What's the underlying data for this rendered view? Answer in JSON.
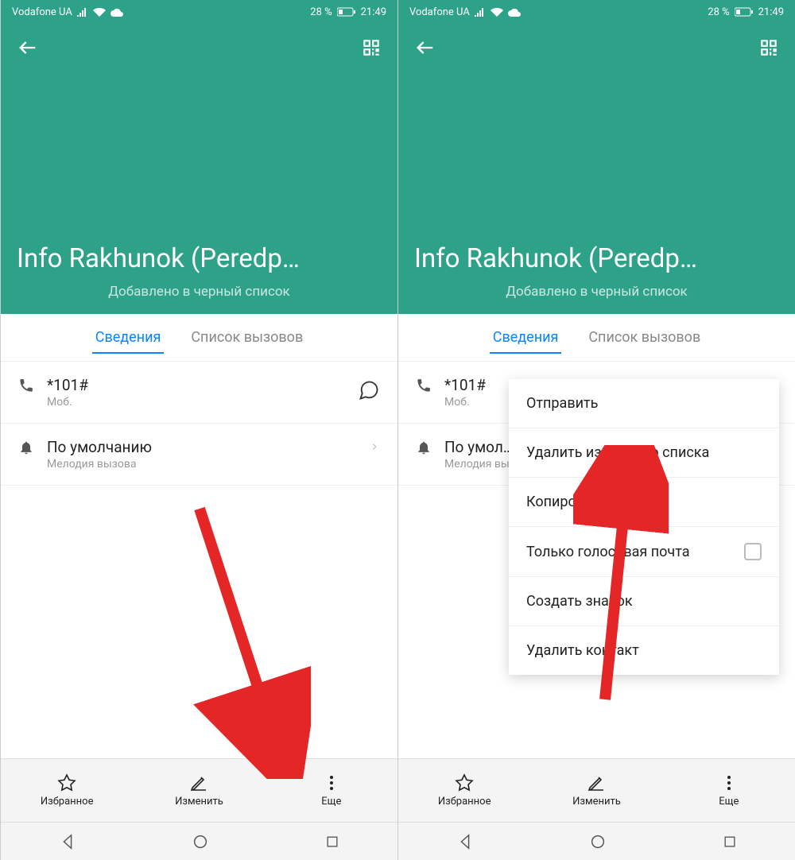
{
  "statusbar": {
    "carrier": "Vodafone UA",
    "battery_pct": "28 %",
    "time": "21:49"
  },
  "header": {
    "title": "Info Rakhunok (Peredp…",
    "subtitle": "Добавлено в черный список"
  },
  "tabs": {
    "details": "Сведения",
    "call_log": "Список вызовов"
  },
  "phone_row": {
    "number": "*101#",
    "type": "Моб."
  },
  "ringtone_row": {
    "title": "По умолчанию",
    "subtitle": "Мелодия вызова"
  },
  "ringtone_row_right_truncated": "По умол…",
  "action_bar": {
    "favorite": "Избранное",
    "edit": "Изменить",
    "more": "Еще"
  },
  "popup": {
    "send": "Отправить",
    "remove_blacklist": "Удалить из черного списка",
    "copy": "Копировать",
    "voicemail_only": "Только голосовая почта",
    "create_shortcut": "Создать значок",
    "delete_contact": "Удалить контакт"
  }
}
